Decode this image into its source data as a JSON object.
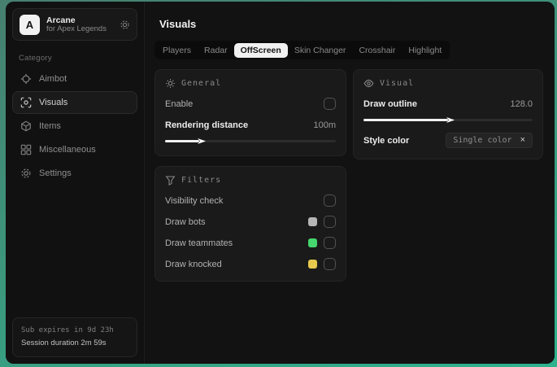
{
  "sidebar": {
    "logo_letter": "A",
    "app_name": "Arcane",
    "app_subtitle": "for Apex Legends",
    "category_label": "Category",
    "items": [
      {
        "label": "Aimbot",
        "icon": "crosshair-icon",
        "selected": false
      },
      {
        "label": "Visuals",
        "icon": "scan-eye-icon",
        "selected": true
      },
      {
        "label": "Items",
        "icon": "cube-icon",
        "selected": false
      },
      {
        "label": "Miscellaneous",
        "icon": "grid-icon",
        "selected": false
      },
      {
        "label": "Settings",
        "icon": "gear-icon",
        "selected": false
      }
    ],
    "footer": {
      "line1": "Sub expires in 9d 23h",
      "line2": "Session duration 2m 59s"
    }
  },
  "main": {
    "title": "Visuals",
    "tabs": [
      {
        "label": "Players",
        "selected": false
      },
      {
        "label": "Radar",
        "selected": false
      },
      {
        "label": "OffScreen",
        "selected": true
      },
      {
        "label": "Skin Changer",
        "selected": false
      },
      {
        "label": "Crosshair",
        "selected": false
      },
      {
        "label": "Highlight",
        "selected": false
      }
    ],
    "panels": {
      "general": {
        "title": "General",
        "icon": "sun-icon",
        "enable_label": "Enable",
        "enable_checked": false,
        "rendering": {
          "label": "Rendering distance",
          "value": "100m",
          "percent": "20%"
        }
      },
      "visual": {
        "title": "Visual",
        "icon": "eye-icon",
        "outline": {
          "label": "Draw outline",
          "value": "128.0",
          "percent": "50%"
        },
        "style": {
          "label": "Style color",
          "chip_label": "Single color",
          "close_glyph": "×"
        }
      },
      "filters": {
        "title": "Filters",
        "icon": "funnel-icon",
        "rows": [
          {
            "label": "Visibility check",
            "checked": false
          },
          {
            "label": "Draw bots",
            "swatch": "#b5b5b5",
            "checked": false
          },
          {
            "label": "Draw teammates",
            "swatch": "#45d66d",
            "checked": false
          },
          {
            "label": "Draw knocked",
            "swatch": "#e6c94d",
            "checked": false
          }
        ]
      }
    }
  },
  "colors": {
    "desktop_teal": "#2db28e",
    "window_bg": "#131313",
    "panel_bg": "#1a1a1a",
    "selected_tab_bg": "#f0f0f0",
    "slider_fill": "#f0f0f0"
  }
}
